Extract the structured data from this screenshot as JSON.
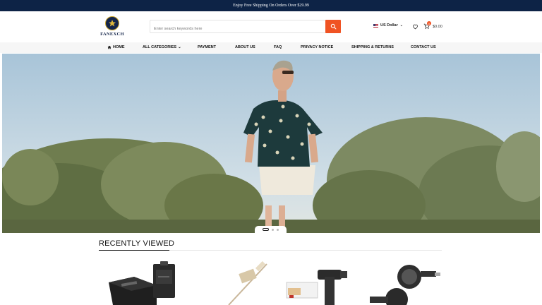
{
  "announcement": "Enjoy Free Shipping On Orders Over $29.99",
  "brand": {
    "name": "FANEXCH",
    "logo_colors": {
      "navy": "#14254a",
      "gold": "#c9a227"
    }
  },
  "search": {
    "placeholder": "Enter search keywords here",
    "button_color": "#f05323"
  },
  "currency": {
    "selected": "US Dollar"
  },
  "cart": {
    "total": "$0.00",
    "count": "0"
  },
  "nav": {
    "home": "HOME",
    "all_categories": "ALL CATEGORIES",
    "payment": "PAYMENT",
    "about": "ABOUT US",
    "faq": "FAQ",
    "privacy": "PRIVACY NOTICE",
    "shipping": "SHIPPING & RETURNS",
    "contact": "CONTACT US"
  },
  "hero": {
    "slides_total": 3,
    "active_slide": 1
  },
  "recently_viewed": {
    "title": "RECENTLY VIEWED",
    "products": [
      "battery-charger-product",
      "probe-thermometer-product",
      "ignition-coil-product",
      "turn-signal-lights-product"
    ]
  },
  "colors": {
    "topbar": "#0d2346",
    "accent": "#f05323",
    "nav_bg": "#f6f6f6"
  }
}
